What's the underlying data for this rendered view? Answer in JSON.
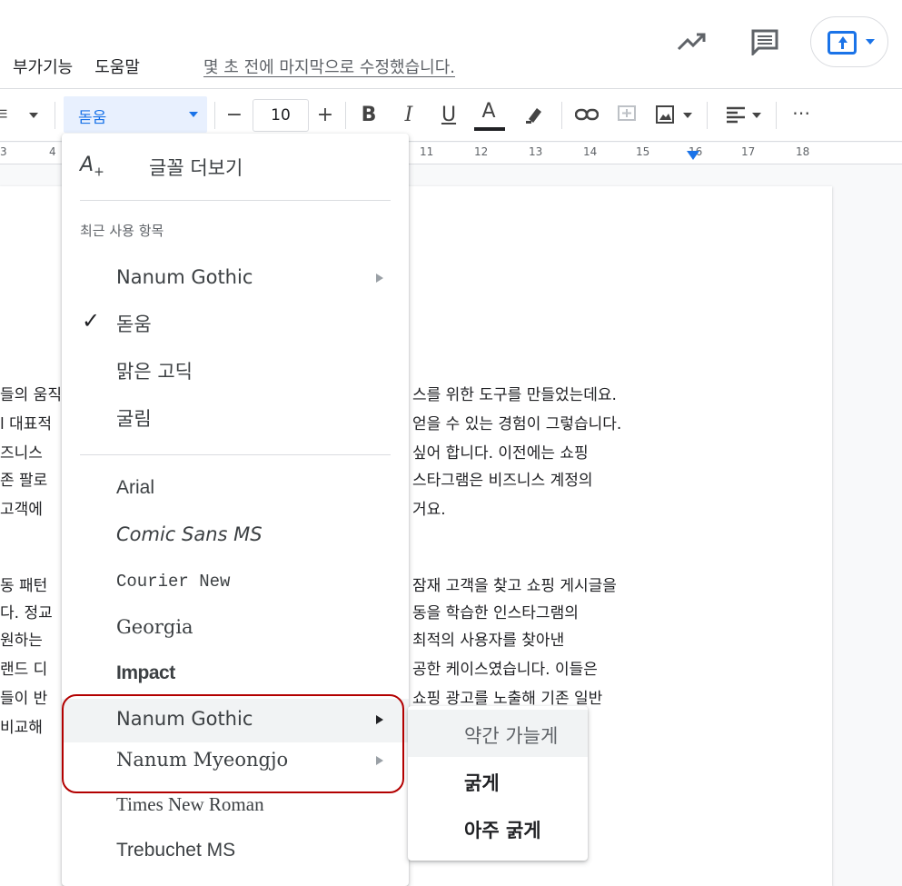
{
  "header": {
    "menu_items": [
      "부가기능",
      "도움말"
    ],
    "last_edit": "몇 초 전에 마지막으로 수정했습니다.",
    "icons": [
      "trending-up-icon",
      "comment-icon",
      "share-icon"
    ]
  },
  "toolbar": {
    "font_select": "돋움",
    "font_size": "10",
    "minus": "−",
    "plus": "+",
    "bold": "B",
    "italic": "I",
    "underline": "U",
    "text_color": "A",
    "more": "⋯",
    "left_caret_label": "ㅌ"
  },
  "ruler": {
    "numbers": [
      "3",
      "4",
      "11",
      "12",
      "13",
      "14",
      "15",
      "16",
      "17",
      "18"
    ]
  },
  "document": {
    "lines": [
      {
        "left": "들의 움직",
        "right": "스를 위한 도구를 만들었는데요."
      },
      {
        "left": "l 대표적",
        "right": "얻을 수 있는 경험이 그렇습니다."
      },
      {
        "left": "즈니스",
        "right": "싶어 합니다. 이전에는 쇼핑"
      },
      {
        "left": "존 팔로",
        "right": "스타그램은 비즈니스 계정의"
      },
      {
        "left": "고객에",
        "right": "거요."
      },
      {
        "left": "동 패턴",
        "right": "잠재 고객을 찾고 쇼핑 게시글을"
      },
      {
        "left": "다. 정교",
        "right": "동을 학습한 인스타그램의"
      },
      {
        "left": "원하는",
        "right": "최적의 사용자를 찾아낸"
      },
      {
        "left": "랜드 디",
        "right": "공한 케이스였습니다. 이들은"
      },
      {
        "left": "들이 반",
        "right": "쇼핑 광고를 노출해 기존 일반"
      },
      {
        "left": "비교해",
        "right": ""
      }
    ]
  },
  "font_menu": {
    "more_fonts": "글꼴 더보기",
    "recent_header": "최근 사용 항목",
    "recent": [
      "Nanum Gothic",
      "돋움",
      "맑은 고딕",
      "굴림"
    ],
    "selected": "돋움",
    "fonts": [
      "Arial",
      "Comic Sans MS",
      "Courier New",
      "Georgia",
      "Impact",
      "Nanum Gothic",
      "Nanum Myeongjo",
      "Times New Roman",
      "Trebuchet MS"
    ]
  },
  "submenu": {
    "items": [
      "약간 가늘게",
      "굵게",
      "아주 굵게"
    ]
  },
  "colors": {
    "accent": "#1a73e8",
    "annotation": "#b30000"
  }
}
